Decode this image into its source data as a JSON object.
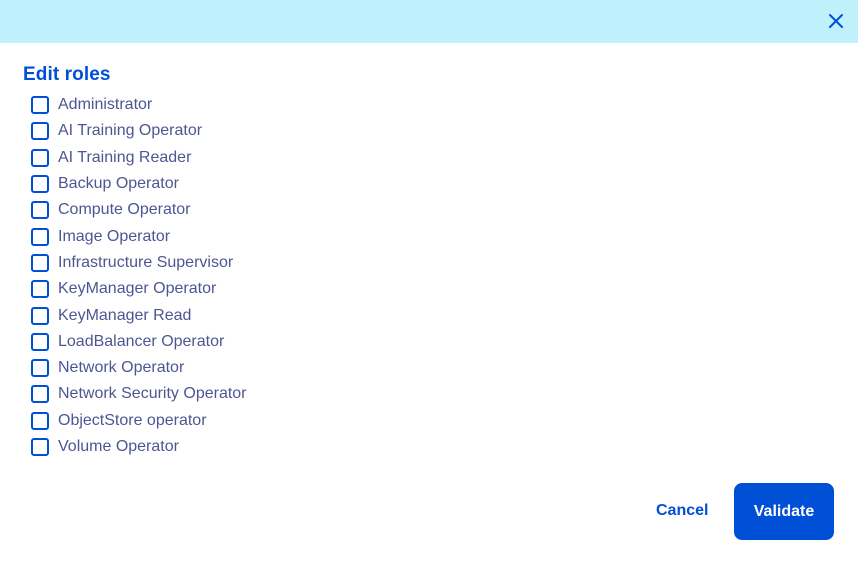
{
  "header": {
    "close_icon": "close-icon",
    "background_color": "#bef1fc"
  },
  "title": "Edit roles",
  "roles": [
    {
      "label": "Administrator",
      "checked": false
    },
    {
      "label": "AI Training Operator",
      "checked": false
    },
    {
      "label": "AI Training Reader",
      "checked": false
    },
    {
      "label": "Backup Operator",
      "checked": false
    },
    {
      "label": "Compute Operator",
      "checked": false
    },
    {
      "label": "Image Operator",
      "checked": false
    },
    {
      "label": "Infrastructure Supervisor",
      "checked": false
    },
    {
      "label": "KeyManager Operator",
      "checked": false
    },
    {
      "label": "KeyManager Read",
      "checked": false
    },
    {
      "label": "LoadBalancer Operator",
      "checked": false
    },
    {
      "label": "Network Operator",
      "checked": false
    },
    {
      "label": "Network Security Operator",
      "checked": false
    },
    {
      "label": "ObjectStore operator",
      "checked": false
    },
    {
      "label": "Volume Operator",
      "checked": false
    }
  ],
  "footer": {
    "cancel_label": "Cancel",
    "validate_label": "Validate"
  },
  "colors": {
    "accent": "#0050d7",
    "label_text": "#4d5693"
  }
}
